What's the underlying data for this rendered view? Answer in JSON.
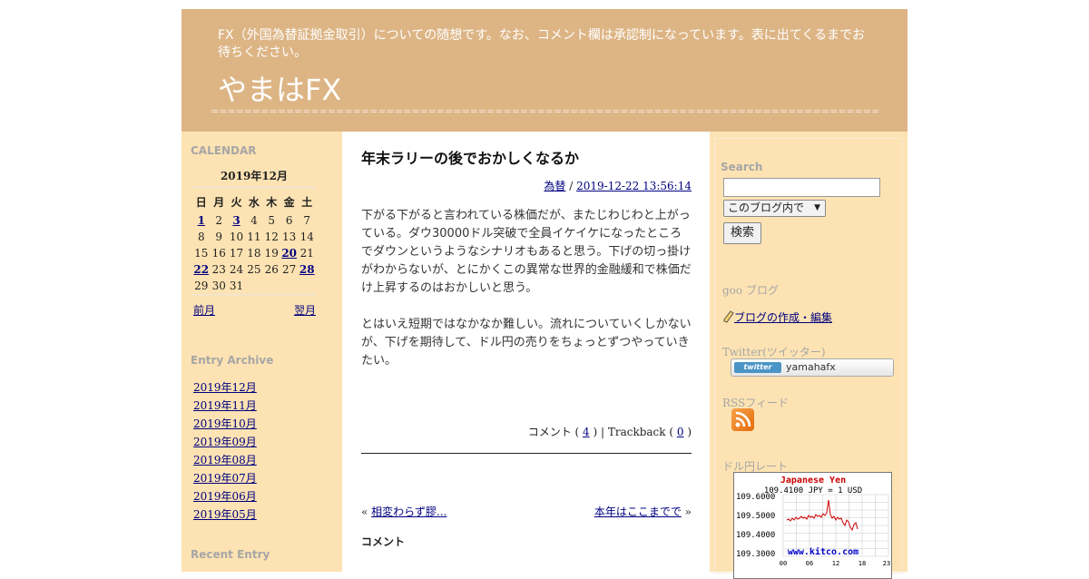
{
  "header": {
    "description": "FX（外国為替証拠金取引）についての随想です。なお、コメント欄は承認制になっています。表に出てくるまでお待ちください。",
    "title": "やまはFX",
    "divider": "============================================================================================"
  },
  "calendar": {
    "heading": "CALENDAR",
    "month": "2019年12月",
    "weekdays": [
      "日",
      "月",
      "火",
      "水",
      "木",
      "金",
      "土"
    ],
    "weeks": [
      [
        "1",
        "2",
        "3",
        "4",
        "5",
        "6",
        "7"
      ],
      [
        "8",
        "9",
        "10",
        "11",
        "12",
        "13",
        "14"
      ],
      [
        "15",
        "16",
        "17",
        "18",
        "19",
        "20",
        "21"
      ],
      [
        "22",
        "23",
        "24",
        "25",
        "26",
        "27",
        "28"
      ],
      [
        "29",
        "30",
        "31",
        "",
        "",
        "",
        ""
      ]
    ],
    "linked_days": [
      "1",
      "3",
      "20",
      "22",
      "28"
    ],
    "prev": "前月",
    "next": "翌月"
  },
  "archive": {
    "heading": "Entry Archive",
    "items": [
      "2019年12月",
      "2019年11月",
      "2019年10月",
      "2019年09月",
      "2019年08月",
      "2019年07月",
      "2019年06月",
      "2019年05月"
    ]
  },
  "recent": {
    "heading": "Recent Entry"
  },
  "post": {
    "title": "年末ラリーの後でおかしくなるか",
    "category": "為替",
    "meta_sep": " / ",
    "datetime": "2019-12-22 13:56:14",
    "paragraphs": [
      "下がる下がると言われている株価だが、またじわじわと上がっている。ダウ30000ドル突破で全員イケイケになったところでダウンというようなシナリオもあると思う。下げの切っ掛けがわからないが、とにかくこの異常な世界的金融緩和で株価だけ上昇するのはおかしいと思う。",
      "とはいえ短期ではなかなか難しい。流れについていくしかないが、下げを期待して、ドル円の売りをちょっとずつやっていきたい。"
    ],
    "comment_label": "コメント ( ",
    "comment_count": "4",
    "trackback_label": " ) | Trackback ( ",
    "trackback_count": "0",
    "close_paren": " )",
    "prev_mark": "« ",
    "prev_link": "相変わらず膠...",
    "next_link": "本年はここまでで",
    "next_mark": " »",
    "comments_heading": "コメント"
  },
  "sidebar": {
    "search_heading": "Search",
    "search_value": "",
    "search_scope": "このブログ内で",
    "search_button": "検索",
    "goo_heading": "goo ブログ",
    "edit_link": "ブログの作成・編集",
    "twitter_heading": "Twitter(ツイッター)",
    "twitter_logo": "twitter",
    "twitter_user": "yamahafx",
    "rss_heading": "RSSフィード",
    "rate_heading": "ドル円レート"
  },
  "rate_widget": {
    "title": "Japanese Yen",
    "quote": "109.4100 JPY = 1 USD",
    "y_ticks": [
      "109.6000",
      "109.5000",
      "109.4000",
      "109.3000"
    ],
    "x_ticks": [
      "00",
      "06",
      "12",
      "18",
      "23"
    ],
    "brand": "www.kitco.com",
    "title_color": "#cc0000",
    "line_color": "#cc0000",
    "brand_color": "#0000cc"
  }
}
